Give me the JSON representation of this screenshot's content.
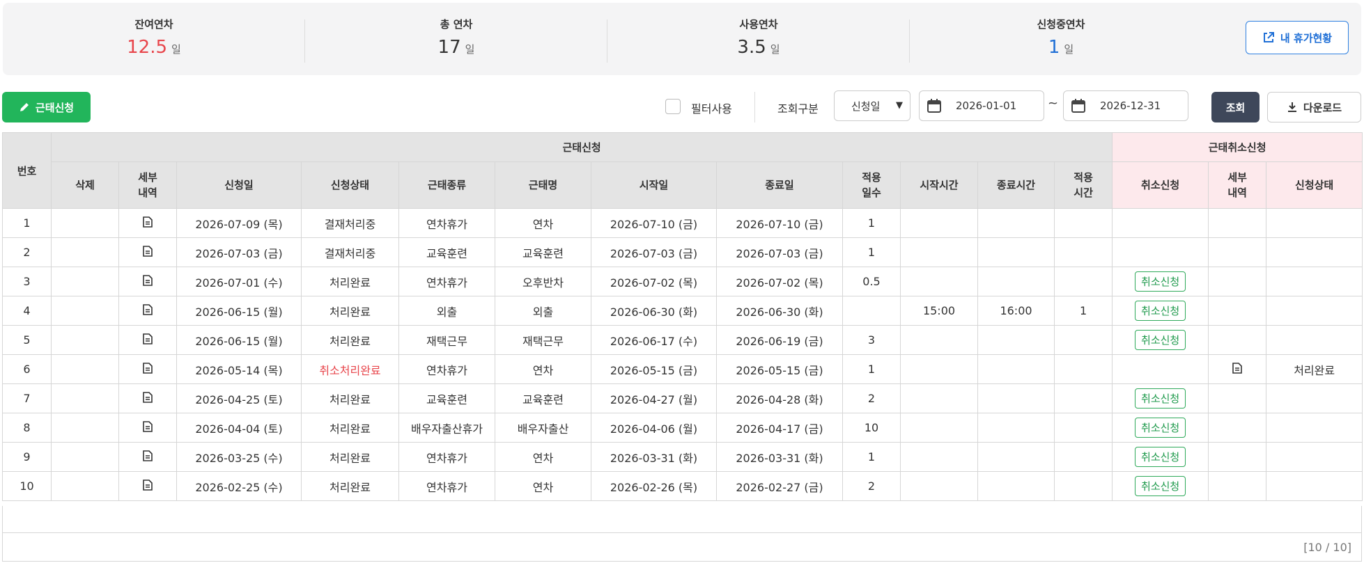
{
  "summary": {
    "remaining": {
      "label": "잔여연차",
      "value": "12.5",
      "unit": "일",
      "color": "#e8454b"
    },
    "total": {
      "label": "총 연차",
      "value": "17",
      "unit": "일",
      "color": "#333333"
    },
    "used": {
      "label": "사용연차",
      "value": "3.5",
      "unit": "일",
      "color": "#333333"
    },
    "pending": {
      "label": "신청중연차",
      "value": "1",
      "unit": "일",
      "color": "#1f6fd6"
    },
    "my_vacation_button": "내 휴가현황"
  },
  "toolbar": {
    "apply_button": "근태신청",
    "filter_label": "필터사용",
    "query_label": "조회구분",
    "query_select": "신청일",
    "date_from": "2026-01-01",
    "date_sep": "~",
    "date_to": "2026-12-31",
    "search_button": "조회",
    "download_button": "다운로드"
  },
  "table": {
    "group_apply": "근태신청",
    "group_cancel": "근태취소신청",
    "headers": {
      "no": "번호",
      "delete": "삭제",
      "detail": "세부 내역",
      "apply_date": "신청일",
      "status": "신청상태",
      "type": "근태종류",
      "name": "근태명",
      "start": "시작일",
      "end": "종료일",
      "days": "적용 일수",
      "start_time": "시작시간",
      "end_time": "종료시간",
      "hours": "적용 시간",
      "cancel_apply": "취소신청",
      "cancel_detail": "세부 내역",
      "cancel_status": "신청상태"
    },
    "rows": [
      {
        "no": "1",
        "apply_date": "2026-07-09 (목)",
        "status": "결재처리중",
        "type": "연차휴가",
        "name": "연차",
        "start": "2026-07-10 (금)",
        "end": "2026-07-10 (금)",
        "days": "1",
        "start_time": "",
        "end_time": "",
        "hours": "",
        "cancel": "",
        "cancel_detail": false,
        "cancel_status": ""
      },
      {
        "no": "2",
        "apply_date": "2026-07-03 (금)",
        "status": "결재처리중",
        "type": "교육훈련",
        "name": "교육훈련",
        "start": "2026-07-03 (금)",
        "end": "2026-07-03 (금)",
        "days": "1",
        "start_time": "",
        "end_time": "",
        "hours": "",
        "cancel": "",
        "cancel_detail": false,
        "cancel_status": ""
      },
      {
        "no": "3",
        "apply_date": "2026-07-01 (수)",
        "status": "처리완료",
        "type": "연차휴가",
        "name": "오후반차",
        "start": "2026-07-02 (목)",
        "end": "2026-07-02 (목)",
        "days": "0.5",
        "start_time": "",
        "end_time": "",
        "hours": "",
        "cancel": "취소신청",
        "cancel_detail": false,
        "cancel_status": ""
      },
      {
        "no": "4",
        "apply_date": "2026-06-15 (월)",
        "status": "처리완료",
        "type": "외출",
        "name": "외출",
        "start": "2026-06-30 (화)",
        "end": "2026-06-30 (화)",
        "days": "",
        "start_time": "15:00",
        "end_time": "16:00",
        "hours": "1",
        "cancel": "취소신청",
        "cancel_detail": false,
        "cancel_status": ""
      },
      {
        "no": "5",
        "apply_date": "2026-06-15 (월)",
        "status": "처리완료",
        "type": "재택근무",
        "name": "재택근무",
        "start": "2026-06-17 (수)",
        "end": "2026-06-19 (금)",
        "days": "3",
        "start_time": "",
        "end_time": "",
        "hours": "",
        "cancel": "취소신청",
        "cancel_detail": false,
        "cancel_status": ""
      },
      {
        "no": "6",
        "apply_date": "2026-05-14 (목)",
        "status": "취소처리완료",
        "status_color": "#e8454b",
        "type": "연차휴가",
        "name": "연차",
        "start": "2026-05-15 (금)",
        "end": "2026-05-15 (금)",
        "days": "1",
        "start_time": "",
        "end_time": "",
        "hours": "",
        "cancel": "",
        "cancel_detail": true,
        "cancel_status": "처리완료"
      },
      {
        "no": "7",
        "apply_date": "2026-04-25 (토)",
        "status": "처리완료",
        "type": "교육훈련",
        "name": "교육훈련",
        "start": "2026-04-27 (월)",
        "end": "2026-04-28 (화)",
        "days": "2",
        "start_time": "",
        "end_time": "",
        "hours": "",
        "cancel": "취소신청",
        "cancel_detail": false,
        "cancel_status": ""
      },
      {
        "no": "8",
        "apply_date": "2026-04-04 (토)",
        "status": "처리완료",
        "type": "배우자출산휴가",
        "name": "배우자출산",
        "start": "2026-04-06 (월)",
        "end": "2026-04-17 (금)",
        "days": "10",
        "start_time": "",
        "end_time": "",
        "hours": "",
        "cancel": "취소신청",
        "cancel_detail": false,
        "cancel_status": ""
      },
      {
        "no": "9",
        "apply_date": "2026-03-25 (수)",
        "status": "처리완료",
        "type": "연차휴가",
        "name": "연차",
        "start": "2026-03-31 (화)",
        "end": "2026-03-31 (화)",
        "days": "1",
        "start_time": "",
        "end_time": "",
        "hours": "",
        "cancel": "취소신청",
        "cancel_detail": false,
        "cancel_status": ""
      },
      {
        "no": "10",
        "apply_date": "2026-02-25 (수)",
        "status": "처리완료",
        "type": "연차휴가",
        "name": "연차",
        "start": "2026-02-26 (목)",
        "end": "2026-02-27 (금)",
        "days": "2",
        "start_time": "",
        "end_time": "",
        "hours": "",
        "cancel": "취소신청",
        "cancel_detail": false,
        "cancel_status": ""
      }
    ]
  },
  "pagination": "[10 / 10]"
}
